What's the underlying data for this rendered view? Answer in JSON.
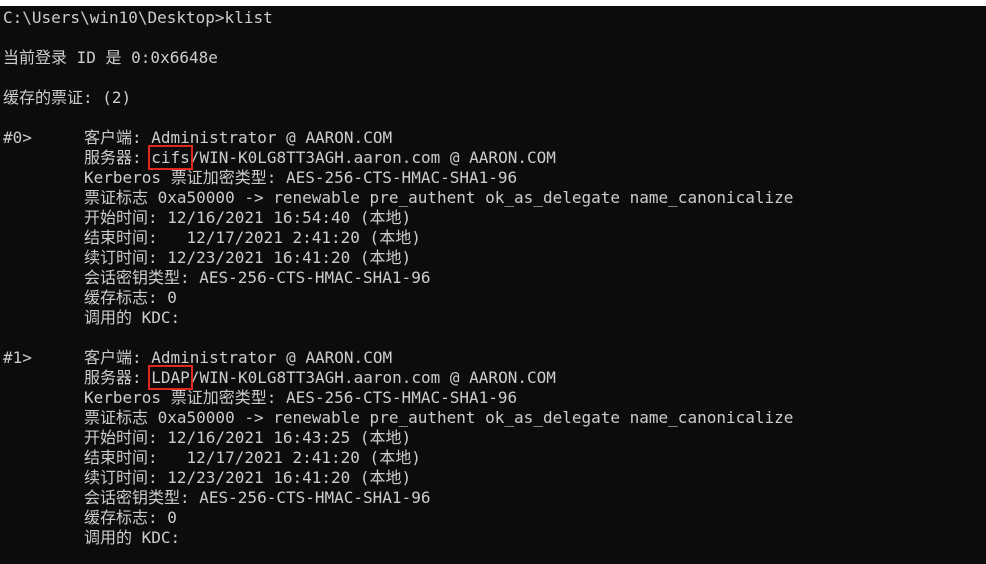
{
  "prompt_line": "C:\\Users\\win10\\Desktop>klist",
  "logon_id_line": "当前登录 ID 是 0:0x6648e",
  "cached_tickets_line": "缓存的票证: (2)",
  "tickets": [
    {
      "index": "#0>",
      "client": "客户端: Administrator @ AARON.COM",
      "server_prefix": "服务器: ",
      "server_service": "cifs",
      "server_rest": "/WIN-K0LG8TT3AGH.aaron.com @ AARON.COM",
      "enc_type": "Kerberos 票证加密类型: AES-256-CTS-HMAC-SHA1-96",
      "flags": "票证标志 0xa50000 -> renewable pre_authent ok_as_delegate name_canonicalize",
      "start_time": "开始时间: 12/16/2021 16:54:40 (本地)",
      "end_time": "结束时间:   12/17/2021 2:41:20 (本地)",
      "renew_time": "续订时间: 12/23/2021 16:41:20 (本地)",
      "session_key": "会话密钥类型: AES-256-CTS-HMAC-SHA1-96",
      "cache_flags": "缓存标志: 0",
      "kdc": "调用的 KDC:"
    },
    {
      "index": "#1>",
      "client": "客户端: Administrator @ AARON.COM",
      "server_prefix": "服务器: ",
      "server_service": "LDAP",
      "server_rest": "/WIN-K0LG8TT3AGH.aaron.com @ AARON.COM",
      "enc_type": "Kerberos 票证加密类型: AES-256-CTS-HMAC-SHA1-96",
      "flags": "票证标志 0xa50000 -> renewable pre_authent ok_as_delegate name_canonicalize",
      "start_time": "开始时间: 12/16/2021 16:43:25 (本地)",
      "end_time": "结束时间:   12/17/2021 2:41:20 (本地)",
      "renew_time": "续订时间: 12/23/2021 16:41:20 (本地)",
      "session_key": "会话密钥类型: AES-256-CTS-HMAC-SHA1-96",
      "cache_flags": "缓存标志: 0",
      "kdc": "调用的 KDC:"
    }
  ],
  "colors": {
    "background": "#0c0c0c",
    "text": "#cccccc",
    "highlight_box": "#e0281e"
  }
}
